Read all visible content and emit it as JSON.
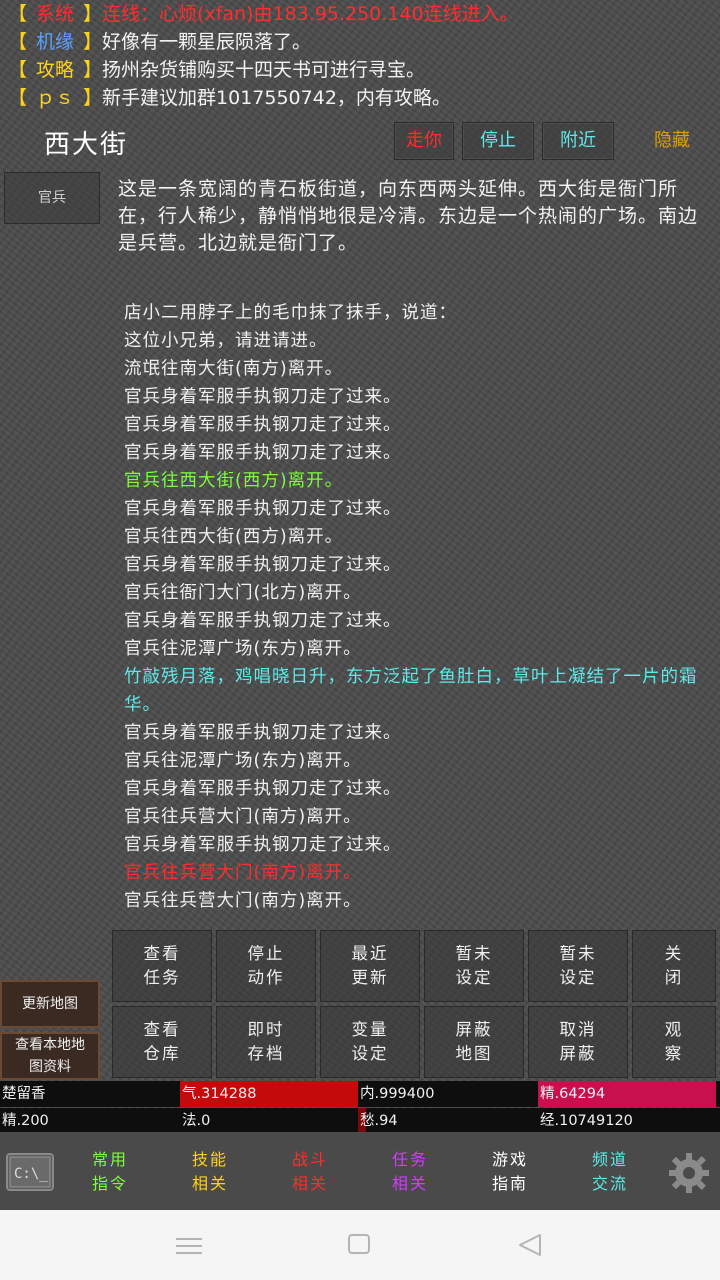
{
  "system_messages": [
    {
      "tag": "系统",
      "text": "连线：心烦(xfan)由183.95.250.140连线进入。"
    },
    {
      "tag": "机缘",
      "text": "好像有一颗星辰陨落了。"
    },
    {
      "tag": "攻略",
      "text": "扬州杂货铺购买十四天书可进行寻宝。"
    },
    {
      "tag": "ｐｓ",
      "text": "新手建议加群1017550742，内有攻略。"
    }
  ],
  "room": {
    "title": "西大街",
    "buttons": {
      "walk": "走你",
      "stop": "停止",
      "nearby": "附近",
      "hide": "隐藏"
    },
    "npc": "官兵",
    "description": "这是一条宽阔的青石板街道，向东西两头延伸。西大街是衙门所在，行人稀少，静悄悄地很是冷清。东边是一个热闹的广场。南边是兵营。北边就是衙门了。"
  },
  "log": [
    {
      "text": "店小二用脖子上的毛巾抹了抹手，说道：",
      "color": "white"
    },
    {
      "text": "这位小兄弟，请进请进。",
      "color": "white"
    },
    {
      "text": "流氓往南大街(南方)离开。",
      "color": "white"
    },
    {
      "text": "官兵身着军服手执钢刀走了过来。",
      "color": "white"
    },
    {
      "text": "官兵身着军服手执钢刀走了过来。",
      "color": "white"
    },
    {
      "text": "官兵身着军服手执钢刀走了过来。",
      "color": "white"
    },
    {
      "text": "官兵往西大街(西方)离开。",
      "color": "green"
    },
    {
      "text": "官兵身着军服手执钢刀走了过来。",
      "color": "white"
    },
    {
      "text": "官兵往西大街(西方)离开。",
      "color": "white"
    },
    {
      "text": "官兵身着军服手执钢刀走了过来。",
      "color": "white"
    },
    {
      "text": "官兵往衙门大门(北方)离开。",
      "color": "white"
    },
    {
      "text": "官兵身着军服手执钢刀走了过来。",
      "color": "white"
    },
    {
      "text": "官兵往泥潭广场(东方)离开。",
      "color": "white"
    },
    {
      "text": "竹敲残月落，鸡唱晓日升，东方泛起了鱼肚白，草叶上凝结了一片的霜华。",
      "color": "cyan"
    },
    {
      "text": "官兵身着军服手执钢刀走了过来。",
      "color": "white"
    },
    {
      "text": "官兵往泥潭广场(东方)离开。",
      "color": "white"
    },
    {
      "text": "官兵身着军服手执钢刀走了过来。",
      "color": "white"
    },
    {
      "text": "官兵往兵营大门(南方)离开。",
      "color": "white"
    },
    {
      "text": "官兵身着军服手执钢刀走了过来。",
      "color": "white"
    },
    {
      "text": "官兵往兵营大门(南方)离开。",
      "color": "red"
    },
    {
      "text": "官兵往兵营大门(南方)离开。",
      "color": "white"
    }
  ],
  "side_buttons": {
    "update_map": "更新地图",
    "local_map_1": "查看本地地",
    "local_map_2": "图资料"
  },
  "grid_row1": [
    {
      "l1": "查看",
      "l2": "任务"
    },
    {
      "l1": "停止",
      "l2": "动作"
    },
    {
      "l1": "最近",
      "l2": "更新"
    },
    {
      "l1": "暂未",
      "l2": "设定"
    },
    {
      "l1": "暂未",
      "l2": "设定"
    },
    {
      "l1": "关",
      "l2": "闭"
    }
  ],
  "grid_row2": [
    {
      "l1": "查看",
      "l2": "仓库"
    },
    {
      "l1": "即时",
      "l2": "存档"
    },
    {
      "l1": "变量",
      "l2": "设定"
    },
    {
      "l1": "屏蔽",
      "l2": "地图"
    },
    {
      "l1": "取消",
      "l2": "屏蔽"
    },
    {
      "l1": "观",
      "l2": "察"
    }
  ],
  "stats_row1": {
    "name": "楚留香",
    "qi": "气.314288",
    "nei": "内.999400",
    "jing": "精.64294"
  },
  "stats_row2": {
    "jing2": "精.200",
    "fa": "法.0",
    "chou": "愁.94",
    "exp": "经.10749120"
  },
  "bottom_nav": [
    {
      "l1": "常用",
      "l2": "指令",
      "color": "#7dff3a"
    },
    {
      "l1": "技能",
      "l2": "相关",
      "color": "#ffd21a"
    },
    {
      "l1": "战斗",
      "l2": "相关",
      "color": "#ff2d2d"
    },
    {
      "l1": "任务",
      "l2": "相关",
      "color": "#d43bff"
    },
    {
      "l1": "游戏",
      "l2": "指南",
      "color": "#ffffff"
    },
    {
      "l1": "频道",
      "l2": "交流",
      "color": "#5fe9e9"
    }
  ],
  "colors": {
    "qi_bg": "#c40a0a",
    "jing_bg": "#c8104f",
    "stats_dark": "#0e0e0e"
  },
  "icons": {
    "left": "cmd-prompt-icon",
    "right": "gear-icon"
  }
}
